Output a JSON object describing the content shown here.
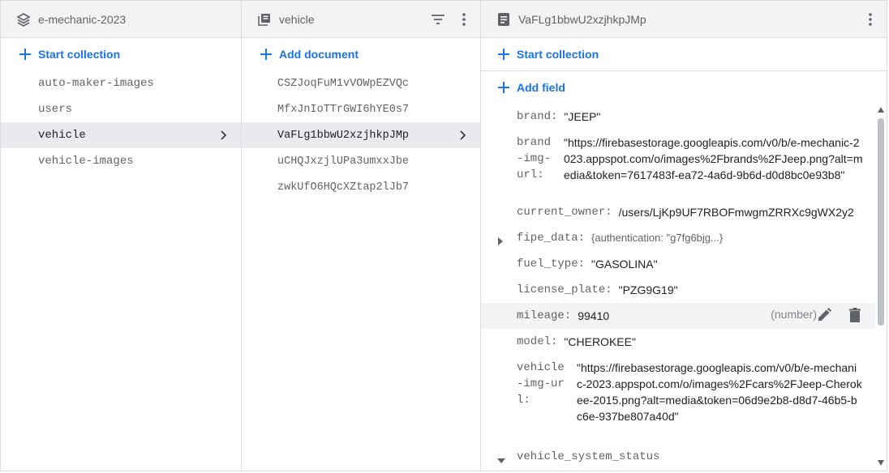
{
  "colors": {
    "accent": "#1a73e8",
    "header_bg": "#f1f3f4",
    "selected_bg": "#e8eaed"
  },
  "panel_root": {
    "title": "e-mechanic-2023",
    "icon": "firebase-stack-icon",
    "add_label": "Start collection",
    "items": [
      "auto-maker-images",
      "users",
      "vehicle",
      "vehicle-images"
    ],
    "selected": "vehicle"
  },
  "panel_collection": {
    "title": "vehicle",
    "icon": "collection-icon",
    "add_label": "Add document",
    "items": [
      "CSZJoqFuM1vVOWpEZVQc",
      "MfxJnIoTTrGWI6hYE0s7",
      "VaFLg1bbwU2xzjhkpJMp",
      "uCHQJxzjlUPa3umxxJbe",
      "zwkUfO6HQcXZtap2lJb7"
    ],
    "selected": "VaFLg1bbwU2xzjhkpJMp"
  },
  "panel_document": {
    "title": "VaFLg1bbwU2xzjhkpJMp",
    "icon": "document-icon",
    "start_collection_label": "Start collection",
    "add_field_label": "Add field",
    "fields": {
      "brand": {
        "key": "brand:",
        "value": "\"JEEP\""
      },
      "brand_img_url": {
        "key": "brand-img-url:",
        "value": "\"https://firebasestorage.googleapis.com/v0/b/e-mechanic-2023.appspot.com/o/images%2Fbrands%2FJeep.png?alt=media&token=7617483f-ea72-4a6d-9b6d-d0d8bc0e93b8\""
      },
      "current_owner": {
        "key": "current_owner:",
        "value": "/users/LjKp9UF7RBOFmwgmZRRXc9gWX2y2"
      },
      "fipe_data": {
        "key": "fipe_data:",
        "value": "{authentication: \"g7fg6bjg...}"
      },
      "fuel_type": {
        "key": "fuel_type:",
        "value": "\"GASOLINA\""
      },
      "license_plate": {
        "key": "license_plate:",
        "value": "\"PZG9G19\""
      },
      "mileage": {
        "key": "mileage:",
        "value": "99410",
        "type": "(number)"
      },
      "model": {
        "key": "model:",
        "value": "\"CHEROKEE\""
      },
      "vehicle_img_url": {
        "key": "vehicle-img-url:",
        "value": "\"https://firebasestorage.googleapis.com/v0/b/e-mechanic-2023.appspot.com/o/images%2Fcars%2FJeep-Cherokee-2015.png?alt=media&token=06d9e2b8-d8d7-46b5-bc6e-937be807a40d\""
      },
      "vehicle_system_status": {
        "key": "vehicle_system_status",
        "value": ""
      }
    }
  }
}
